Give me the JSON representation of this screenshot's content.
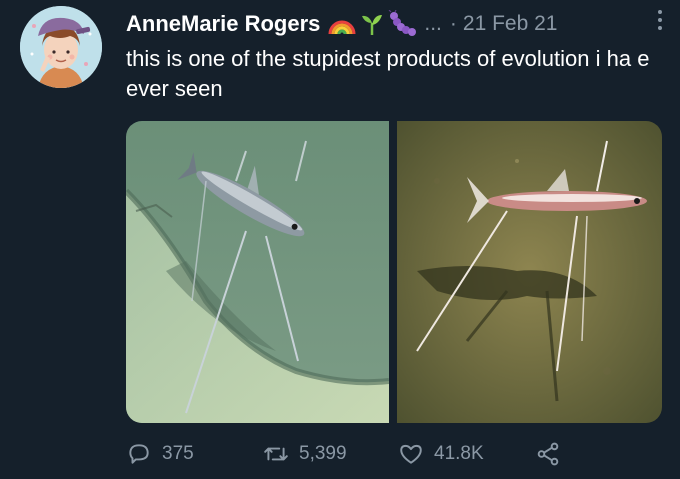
{
  "tweet": {
    "author_name": "AnneMarie Rogers",
    "handle_ellipsis": "...",
    "separator": "·",
    "date": "21 Feb 21",
    "text": "this is one of the stupidest products of evolution i ha e ever seen",
    "author_emojis": [
      "rainbow-emoji",
      "seedling-emoji",
      "caterpillar-emoji"
    ]
  },
  "media": {
    "images": [
      {
        "subject": "tripod fish on sandy slope",
        "icon": "photo-left"
      },
      {
        "subject": "tripod fish on seafloor with shadow",
        "icon": "photo-right"
      }
    ]
  },
  "stats": {
    "replies": "375",
    "retweets": "5,399",
    "likes": "41.8K"
  },
  "icons": {
    "reply": "reply-icon",
    "retweet": "retweet-icon",
    "like": "heart-icon",
    "share": "share-icon",
    "more": "more-options-icon"
  },
  "colors": {
    "background": "#15202b",
    "text": "#ffffff",
    "secondary_text": "#8b98a5"
  }
}
